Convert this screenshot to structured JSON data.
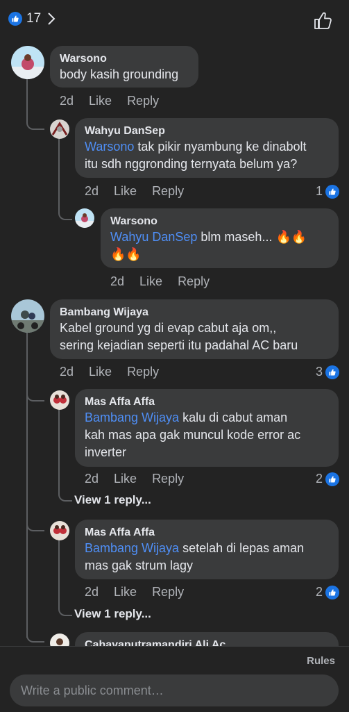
{
  "header": {
    "like_count": "17"
  },
  "comments": [
    {
      "name": "Warsono",
      "text": "body kasih grounding",
      "time": "2d",
      "like": "Like",
      "reply": "Reply"
    },
    {
      "name": "Wahyu DanSep",
      "mention": "Warsono",
      "text_line1": " tak pikir nyambung ke dinabolt",
      "text_line2": "itu sdh nggronding ternyata belum ya?",
      "time": "2d",
      "like": "Like",
      "reply": "Reply",
      "reactions": "1"
    },
    {
      "name": "Warsono",
      "mention": "Wahyu DanSep",
      "text_line1": " blm maseh... 🔥🔥",
      "text_line2": "🔥🔥",
      "time": "2d",
      "like": "Like",
      "reply": "Reply"
    },
    {
      "name": "Bambang Wijaya",
      "text_line1": "Kabel ground yg di evap cabut aja om,,",
      "text_line2": "sering kejadian seperti itu padahal AC baru",
      "time": "2d",
      "like": "Like",
      "reply": "Reply",
      "reactions": "3"
    },
    {
      "name": "Mas Affa Affa",
      "mention": "Bambang Wijaya",
      "text_line1": " kalu  di cabut aman",
      "text_line2": "kah mas apa gak muncul kode error ac",
      "text_line3": "inverter",
      "time": "2d",
      "like": "Like",
      "reply": "Reply",
      "reactions": "2",
      "view_replies": "View 1 reply..."
    },
    {
      "name": "Mas Affa Affa",
      "mention": "Bambang Wijaya",
      "text_line1": " setelah di lepas aman",
      "text_line2": "mas gak strum lagy",
      "time": "2d",
      "like": "Like",
      "reply": "Reply",
      "reactions": "2",
      "view_replies": "View 1 reply..."
    },
    {
      "name": "Cahayaputramandiri Ali Ac"
    }
  ],
  "footer": {
    "rules": "Rules",
    "placeholder": "Write a public comment…"
  },
  "colors": {
    "background": "#232323",
    "bubble": "#3a3b3c",
    "mention": "#4f8ff7",
    "like_blue": "#1b74e4"
  }
}
